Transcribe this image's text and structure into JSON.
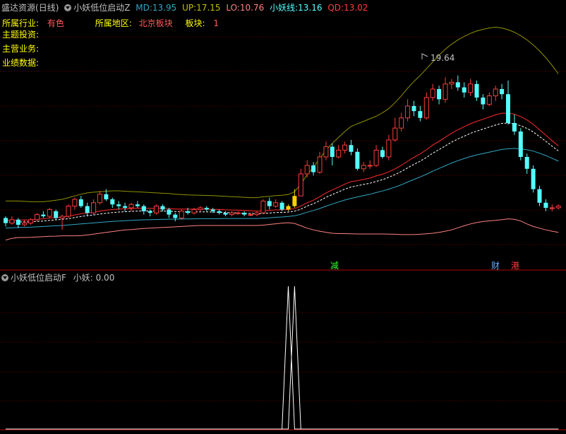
{
  "header": {
    "stock_name": "盛达资源",
    "period": "(日线)",
    "indicator_name": "小妖低位启动Z",
    "md_label": "MD:",
    "md_value": "13.95",
    "up_label": "UP:",
    "up_value": "17.15",
    "lo_label": "LO:",
    "lo_value": "10.76",
    "xyx_label": "小妖线:",
    "xyx_value": "13.16",
    "qd_label": "QD:",
    "qd_value": "13.02"
  },
  "info": {
    "industry_label": "所属行业:",
    "industry_value": "有色",
    "region_label": "所属地区:",
    "region_value": "北京板块",
    "board_label": "板块:",
    "board_value": "1",
    "theme_label": "主题投资:",
    "business_label": "主营业务:",
    "performance_label": "业绩数据:"
  },
  "markers": {
    "peak_label": "19.64",
    "event_reduce": "减",
    "event_finance": "财",
    "event_hk": "港"
  },
  "sub_panel": {
    "indicator_name": "小妖低位启动F",
    "value_label": "小妖:",
    "value": "0.00"
  },
  "colors": {
    "background": "#000000",
    "up_candle": "#ff3c3c",
    "down_candle": "#54ffff",
    "signal_candle": "#ffd000",
    "md_line": "#ff2a2a",
    "up_line": "#909000",
    "lo_line": "#ff8080",
    "xyx_line": "#ffffff",
    "qd_line": "#31a7c4",
    "grid": "#7a0000",
    "signal_line": "#ffffff"
  },
  "chart_data": {
    "type": "candlestick",
    "price_candles": [
      [
        10.9,
        10.6,
        11.0,
        10.4
      ],
      [
        10.6,
        10.8,
        11.0,
        10.5
      ],
      [
        10.8,
        10.5,
        10.9,
        10.3
      ],
      [
        10.5,
        10.6,
        10.8,
        10.4
      ],
      [
        10.6,
        10.8,
        10.9,
        10.5
      ],
      [
        10.8,
        11.1,
        11.2,
        10.7
      ],
      [
        11.1,
        11.0,
        11.3,
        10.9
      ],
      [
        11.0,
        11.4,
        11.5,
        10.9
      ],
      [
        11.3,
        10.9,
        11.4,
        10.8
      ],
      [
        10.9,
        11.0,
        11.1,
        10.2
      ],
      [
        11.0,
        11.6,
        11.7,
        10.9
      ],
      [
        11.6,
        12.0,
        12.1,
        11.4
      ],
      [
        12.0,
        11.6,
        12.2,
        11.5
      ],
      [
        11.6,
        11.2,
        11.8,
        11.0
      ],
      [
        11.2,
        11.8,
        12.0,
        11.1
      ],
      [
        11.8,
        12.3,
        12.5,
        11.7
      ],
      [
        12.3,
        12.0,
        12.6,
        11.9
      ],
      [
        12.0,
        11.7,
        12.1,
        11.5
      ],
      [
        11.7,
        11.6,
        11.9,
        11.4
      ],
      [
        11.6,
        11.5,
        11.8,
        11.3
      ],
      [
        11.5,
        11.7,
        11.8,
        11.3
      ],
      [
        11.7,
        11.6,
        11.9,
        11.5
      ],
      [
        11.6,
        11.3,
        11.7,
        11.1
      ],
      [
        11.3,
        11.2,
        11.4,
        11.0
      ],
      [
        11.2,
        11.6,
        11.7,
        11.1
      ],
      [
        11.6,
        11.4,
        11.7,
        11.3
      ],
      [
        11.4,
        11.1,
        11.5,
        10.9
      ],
      [
        11.1,
        10.9,
        11.2,
        10.7
      ],
      [
        10.9,
        11.3,
        11.4,
        10.8
      ],
      [
        11.3,
        11.2,
        11.5,
        11.1
      ],
      [
        11.2,
        11.4,
        11.5,
        11.1
      ],
      [
        11.4,
        11.5,
        11.6,
        11.3
      ],
      [
        11.5,
        11.4,
        11.6,
        11.3
      ],
      [
        11.4,
        11.3,
        11.5,
        11.2
      ],
      [
        11.3,
        11.2,
        11.4,
        11.1
      ],
      [
        11.2,
        11.1,
        11.3,
        11.0
      ],
      [
        11.1,
        11.2,
        11.3,
        11.0
      ],
      [
        11.2,
        11.2,
        11.3,
        11.1
      ],
      [
        11.2,
        11.1,
        11.3,
        11.0
      ],
      [
        11.1,
        11.1,
        11.2,
        11.0
      ],
      [
        11.1,
        11.2,
        11.3,
        11.0
      ],
      [
        11.2,
        11.9,
        12.0,
        11.2
      ],
      [
        11.9,
        11.6,
        12.1,
        11.4
      ],
      [
        11.6,
        11.8,
        12.0,
        11.5
      ],
      [
        11.8,
        11.4,
        11.9,
        11.3
      ],
      [
        11.4,
        11.6,
        11.7,
        11.3
      ],
      [
        11.6,
        12.2,
        12.6,
        11.5
      ],
      [
        12.2,
        13.5,
        13.8,
        12.2
      ],
      [
        13.5,
        14.0,
        14.3,
        13.3
      ],
      [
        14.0,
        13.6,
        14.2,
        13.4
      ],
      [
        13.6,
        14.5,
        14.8,
        13.5
      ],
      [
        14.5,
        15.1,
        15.4,
        14.3
      ],
      [
        15.1,
        14.5,
        15.3,
        14.0
      ],
      [
        14.5,
        14.9,
        15.2,
        14.4
      ],
      [
        14.9,
        15.2,
        15.4,
        14.7
      ],
      [
        15.2,
        14.8,
        15.5,
        14.6
      ],
      [
        14.8,
        13.8,
        15.0,
        13.7
      ],
      [
        13.8,
        14.0,
        14.2,
        13.6
      ],
      [
        14.0,
        14.0,
        14.3,
        13.8
      ],
      [
        14.0,
        14.9,
        15.2,
        13.9
      ],
      [
        14.9,
        14.5,
        15.1,
        14.4
      ],
      [
        14.5,
        15.5,
        15.8,
        14.3
      ],
      [
        15.5,
        16.2,
        16.8,
        15.4
      ],
      [
        16.2,
        16.8,
        17.1,
        16.0
      ],
      [
        16.8,
        17.5,
        17.9,
        16.6
      ],
      [
        17.5,
        17.2,
        17.8,
        16.9
      ],
      [
        17.2,
        16.8,
        17.5,
        16.6
      ],
      [
        16.8,
        18.0,
        18.3,
        16.7
      ],
      [
        18.0,
        18.5,
        18.8,
        17.8
      ],
      [
        18.5,
        17.9,
        18.7,
        17.6
      ],
      [
        17.9,
        18.8,
        19.2,
        17.7
      ],
      [
        18.8,
        18.9,
        19.1,
        18.5
      ],
      [
        18.9,
        18.6,
        19.3,
        18.4
      ],
      [
        18.6,
        18.3,
        18.9,
        18.0
      ],
      [
        18.3,
        18.8,
        19.1,
        18.1
      ],
      [
        18.8,
        18.0,
        19.0,
        17.8
      ],
      [
        18.0,
        17.6,
        18.2,
        17.3
      ],
      [
        17.6,
        18.1,
        18.3,
        17.5
      ],
      [
        18.1,
        18.5,
        18.7,
        17.8
      ],
      [
        18.5,
        18.2,
        18.8,
        17.9
      ],
      [
        18.2,
        16.5,
        19.0,
        16.4
      ],
      [
        16.5,
        16.0,
        17.0,
        15.8
      ],
      [
        16.0,
        14.5,
        16.2,
        14.3
      ],
      [
        14.5,
        13.8,
        14.7,
        13.5
      ],
      [
        13.8,
        12.6,
        14.0,
        12.4
      ],
      [
        12.6,
        11.8,
        12.8,
        11.6
      ],
      [
        11.8,
        11.5,
        12.0,
        11.3
      ],
      [
        11.5,
        11.5,
        11.7,
        11.3
      ],
      [
        11.5,
        11.6,
        11.7,
        11.4
      ]
    ],
    "signal_indices": [
      45,
      46
    ],
    "md_line": [
      10.75,
      10.77,
      10.78,
      10.78,
      10.79,
      10.82,
      10.85,
      10.9,
      10.92,
      10.95,
      11.0,
      11.08,
      11.15,
      11.2,
      11.24,
      11.3,
      11.36,
      11.4,
      11.42,
      11.44,
      11.46,
      11.48,
      11.48,
      11.47,
      11.48,
      11.48,
      11.46,
      11.43,
      11.43,
      11.42,
      11.42,
      11.42,
      11.42,
      11.41,
      11.4,
      11.38,
      11.37,
      11.36,
      11.34,
      11.32,
      11.3,
      11.33,
      11.35,
      11.38,
      11.38,
      11.4,
      11.45,
      11.6,
      11.8,
      11.95,
      12.15,
      12.38,
      12.55,
      12.72,
      12.9,
      13.04,
      13.1,
      13.18,
      13.25,
      13.38,
      13.48,
      13.62,
      13.8,
      14.0,
      14.25,
      14.48,
      14.68,
      14.92,
      15.2,
      15.42,
      15.66,
      15.9,
      16.1,
      16.28,
      16.46,
      16.6,
      16.72,
      16.85,
      16.98,
      17.08,
      17.08,
      17.02,
      16.88,
      16.68,
      16.42,
      16.1,
      15.78,
      15.45,
      15.15
    ],
    "up_line": [
      11.9,
      11.9,
      11.9,
      11.88,
      11.86,
      11.86,
      11.86,
      11.9,
      11.95,
      12.0,
      12.1,
      12.2,
      12.3,
      12.38,
      12.42,
      12.45,
      12.48,
      12.5,
      12.5,
      12.48,
      12.46,
      12.44,
      12.42,
      12.4,
      12.38,
      12.36,
      12.34,
      12.3,
      12.28,
      12.26,
      12.25,
      12.24,
      12.23,
      12.22,
      12.2,
      12.18,
      12.16,
      12.14,
      12.12,
      12.1,
      12.1,
      12.15,
      12.18,
      12.22,
      12.24,
      12.28,
      12.45,
      12.9,
      13.45,
      13.9,
      14.4,
      14.9,
      15.3,
      15.65,
      16.0,
      16.3,
      16.45,
      16.6,
      16.75,
      16.9,
      17.1,
      17.35,
      17.7,
      18.1,
      18.55,
      18.95,
      19.3,
      19.7,
      20.1,
      20.5,
      20.85,
      21.15,
      21.4,
      21.6,
      21.78,
      21.92,
      22.02,
      22.1,
      22.15,
      22.1,
      22.0,
      21.85,
      21.65,
      21.4,
      21.1,
      20.75,
      20.35,
      19.9,
      19.4
    ],
    "lo_line": [
      9.6,
      9.7,
      9.75,
      9.75,
      9.76,
      9.78,
      9.8,
      9.82,
      9.83,
      9.85,
      9.85,
      9.85,
      9.86,
      9.9,
      9.95,
      10.0,
      10.05,
      10.1,
      10.15,
      10.2,
      10.22,
      10.25,
      10.28,
      10.3,
      10.32,
      10.34,
      10.36,
      10.38,
      10.4,
      10.42,
      10.44,
      10.46,
      10.46,
      10.46,
      10.46,
      10.46,
      10.46,
      10.46,
      10.46,
      10.46,
      10.46,
      10.48,
      10.52,
      10.56,
      10.6,
      10.62,
      10.58,
      10.44,
      10.3,
      10.2,
      10.12,
      10.06,
      10.0,
      9.98,
      9.98,
      9.97,
      9.96,
      9.96,
      9.96,
      9.96,
      9.96,
      9.95,
      9.94,
      9.92,
      9.92,
      9.92,
      9.94,
      9.97,
      10.0,
      10.05,
      10.12,
      10.2,
      10.32,
      10.44,
      10.55,
      10.63,
      10.69,
      10.73,
      10.76,
      10.8,
      10.85,
      10.82,
      10.72,
      10.55,
      10.4,
      10.3,
      10.2,
      10.12,
      10.05
    ],
    "xyx_line": [
      10.65,
      10.66,
      10.67,
      10.67,
      10.68,
      10.7,
      10.72,
      10.76,
      10.79,
      10.82,
      10.86,
      10.93,
      10.99,
      11.04,
      11.08,
      11.13,
      11.18,
      11.22,
      11.25,
      11.27,
      11.29,
      11.31,
      11.32,
      11.31,
      11.31,
      11.31,
      11.3,
      11.28,
      11.27,
      11.26,
      11.26,
      11.26,
      11.26,
      11.25,
      11.24,
      11.22,
      11.21,
      11.2,
      11.18,
      11.17,
      11.15,
      11.17,
      11.19,
      11.22,
      11.23,
      11.25,
      11.3,
      11.42,
      11.6,
      11.74,
      11.92,
      12.12,
      12.28,
      12.44,
      12.6,
      12.73,
      12.8,
      12.88,
      12.95,
      13.06,
      13.16,
      13.3,
      13.46,
      13.64,
      13.86,
      14.06,
      14.25,
      14.47,
      14.72,
      14.93,
      15.15,
      15.37,
      15.56,
      15.72,
      15.89,
      16.02,
      16.14,
      16.26,
      16.38,
      16.48,
      16.49,
      16.45,
      16.34,
      16.18,
      15.97,
      15.7,
      15.42,
      15.13,
      14.86
    ],
    "qd_line": [
      10.3,
      10.32,
      10.34,
      10.35,
      10.36,
      10.38,
      10.4,
      10.42,
      10.44,
      10.46,
      10.49,
      10.52,
      10.55,
      10.58,
      10.61,
      10.64,
      10.67,
      10.7,
      10.72,
      10.74,
      10.76,
      10.78,
      10.79,
      10.8,
      10.81,
      10.82,
      10.83,
      10.83,
      10.84,
      10.84,
      10.85,
      10.86,
      10.86,
      10.86,
      10.86,
      10.87,
      10.87,
      10.87,
      10.87,
      10.87,
      10.87,
      10.89,
      10.91,
      10.94,
      10.96,
      10.99,
      11.03,
      11.12,
      11.24,
      11.34,
      11.46,
      11.6,
      11.72,
      11.84,
      11.96,
      12.06,
      12.14,
      12.22,
      12.3,
      12.4,
      12.49,
      12.6,
      12.72,
      12.86,
      13.02,
      13.17,
      13.32,
      13.48,
      13.66,
      13.82,
      13.98,
      14.14,
      14.28,
      14.4,
      14.52,
      14.62,
      14.7,
      14.78,
      14.86,
      14.94,
      14.98,
      15.0,
      14.98,
      14.92,
      14.84,
      14.72,
      14.58,
      14.42,
      14.25
    ],
    "price_range": [
      8.0,
      23.0
    ],
    "grid": true,
    "sub_signal": {
      "values": [
        0,
        0,
        0,
        0,
        0,
        0,
        0,
        0,
        0,
        0,
        0,
        0,
        0,
        0,
        0,
        0,
        0,
        0,
        0,
        0,
        0,
        0,
        0,
        0,
        0,
        0,
        0,
        0,
        0,
        0,
        0,
        0,
        0,
        0,
        0,
        0,
        0,
        0,
        0,
        0,
        0,
        0,
        0,
        0,
        0,
        0,
        1,
        0,
        0,
        0,
        0,
        0,
        0,
        0,
        0,
        0,
        0,
        0,
        0,
        0,
        0,
        0,
        0,
        0,
        0,
        0,
        0,
        0,
        0,
        0,
        0,
        0,
        0,
        0,
        0,
        0,
        0,
        0,
        0,
        0,
        0,
        0,
        0,
        0,
        0,
        0,
        0,
        0,
        0
      ],
      "values_b": [
        0,
        0,
        0,
        0,
        0,
        0,
        0,
        0,
        0,
        0,
        0,
        0,
        0,
        0,
        0,
        0,
        0,
        0,
        0,
        0,
        0,
        0,
        0,
        0,
        0,
        0,
        0,
        0,
        0,
        0,
        0,
        0,
        0,
        0,
        0,
        0,
        0,
        0,
        0,
        0,
        0,
        0,
        0,
        0,
        0,
        1,
        0,
        0,
        0,
        0,
        0,
        0,
        0,
        0,
        0,
        0,
        0,
        0,
        0,
        0,
        0,
        0,
        0,
        0,
        0,
        0,
        0,
        0,
        0,
        0,
        0,
        0,
        0,
        0,
        0,
        0,
        0,
        0,
        0,
        0,
        0,
        0,
        0,
        0,
        0,
        0,
        0,
        0,
        0
      ],
      "range": [
        0,
        1
      ]
    }
  }
}
